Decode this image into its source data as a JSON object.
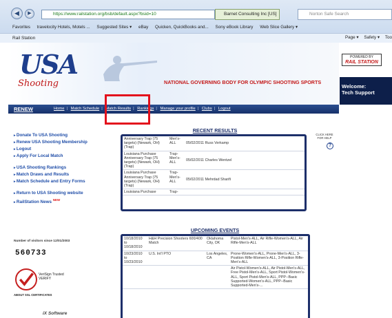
{
  "browser": {
    "url": "https://www.railstation.org/bsb/default.aspx?bsid=10",
    "tab_title": "Barnet Consulting Inc [US]",
    "search_placeholder": "Norton Safe Search",
    "favorites_label": "Favorites",
    "favorites": [
      "travelocity Hotels, Motels ...",
      "Suggested Sites ▾",
      "eBay",
      "Quicken, QuickBooks and...",
      "Sony eBook Library",
      "Web Slice Gallery ▾"
    ],
    "page_tab": "Rail Station",
    "toolbar": [
      "Page ▾",
      "Safety ▾",
      "Too"
    ]
  },
  "header": {
    "logo_usa": "USA",
    "logo_shooting": "Shooting",
    "tagline": "NATIONAL GOVERNING BODY FOR OLYMPIC SHOOTING SPORTS",
    "powered_by": "POWERED BY",
    "rail_station": "RAIL STATION",
    "welcome": "Welcome:",
    "welcome_user": "Tech Support"
  },
  "nav": {
    "renew": "RENEW",
    "links": [
      "Home",
      "Match Schedule",
      "Match Results",
      "Rankings",
      "Manage your profile",
      "Clubs",
      "Logout"
    ]
  },
  "sidebar": {
    "group1": [
      "Donate To USA Shooting",
      "Renew USA Shooting Membership",
      "Logout",
      "Apply For Local Match"
    ],
    "group2": [
      "USA Shooting Rankings",
      "Match Draws and Results",
      "Match Schedule and Entry Forms"
    ],
    "group3": [
      "Return to USA Shooting website",
      "RailStation News"
    ],
    "new_badge": "NEW"
  },
  "visitors": {
    "label": "Number of visitors since 12/01/2003",
    "count": "560733"
  },
  "badges": {
    "verisign": "VeriSign Trusted",
    "verisign_verify": "VERIFY",
    "ssl_label": "ABOUT SSL CERTIFICATES",
    "ix": "iX Software"
  },
  "results": {
    "title": "RECENT RESULTS",
    "help": "CLICK HERE FOR HELP",
    "rows": [
      {
        "match": "Anniversary Trap (75 targets) (Newark, OH) (Trap)",
        "cat": "Men's-ALL",
        "date": "05/02/2011",
        "name": "Russ Verkamp"
      },
      {
        "match": "Louisiana Purchase Anniversary Trap (75 targets) (Newark, OH) (Trap)",
        "cat": "Trap-Men's-ALL",
        "date": "05/02/2011",
        "name": "Charles Wentzel"
      },
      {
        "match": "Louisiana Purchase Anniversary Trap (75 targets) (Newark, OH) (Trap)",
        "cat": "Trap-Men's-ALL",
        "date": "05/02/2011",
        "name": "Mehrdad Sharifi"
      },
      {
        "match": "Louisiana Purchase",
        "cat": "Trap-",
        "date": "",
        "name": ""
      }
    ]
  },
  "events": {
    "title": "UPCOMING EVENTS",
    "rows": [
      {
        "dates": "10/18/2010 to 10/18/2010",
        "name": "H&H Precision Shooters 600/400 Match",
        "loc": "Oklahoma City, OK",
        "cats": "Pistol-Men's-ALL, Air Rifle-Women's-ALL, Air Rifle-Men's-ALL"
      },
      {
        "dates": "10/23/2010 to 10/23/2010",
        "name": "U.S. Int'l PTO",
        "loc": "Los Angeles, CA",
        "cats": "Prone-Women's-ALL, Prone-Men's-ALL, 3-Position Rifle-Women's-ALL, 3-Position Rifle-Men's-ALL"
      },
      {
        "dates": "",
        "name": "",
        "loc": "",
        "cats": "Air Pistol-Women's-ALL, Air Pistol-Men's-ALL, Free Pistol-Men's-ALL, Sport Pistol-Women's-ALL, Sport Pistol-Men's-ALL, PPP--Basic Supported-Women's-ALL, PPP--Basic Supported-Men's-..."
      }
    ]
  }
}
